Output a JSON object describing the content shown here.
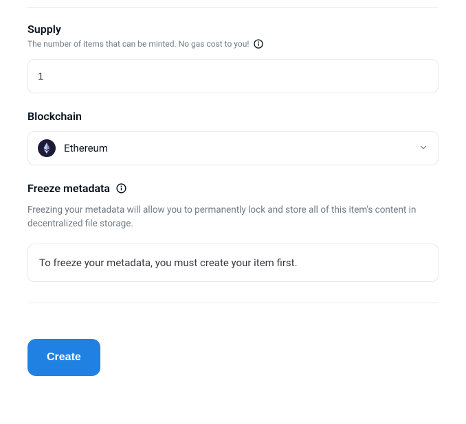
{
  "supply": {
    "label": "Supply",
    "desc": "The number of items that can be minted. No gas cost to you!",
    "value": "1"
  },
  "blockchain": {
    "label": "Blockchain",
    "selected": "Ethereum"
  },
  "freeze": {
    "label": "Freeze metadata",
    "desc": "Freezing your metadata will allow you to permanently lock and store all of this item's content in decentralized file storage.",
    "notice": "To freeze your metadata, you must create your item first."
  },
  "actions": {
    "create": "Create"
  }
}
